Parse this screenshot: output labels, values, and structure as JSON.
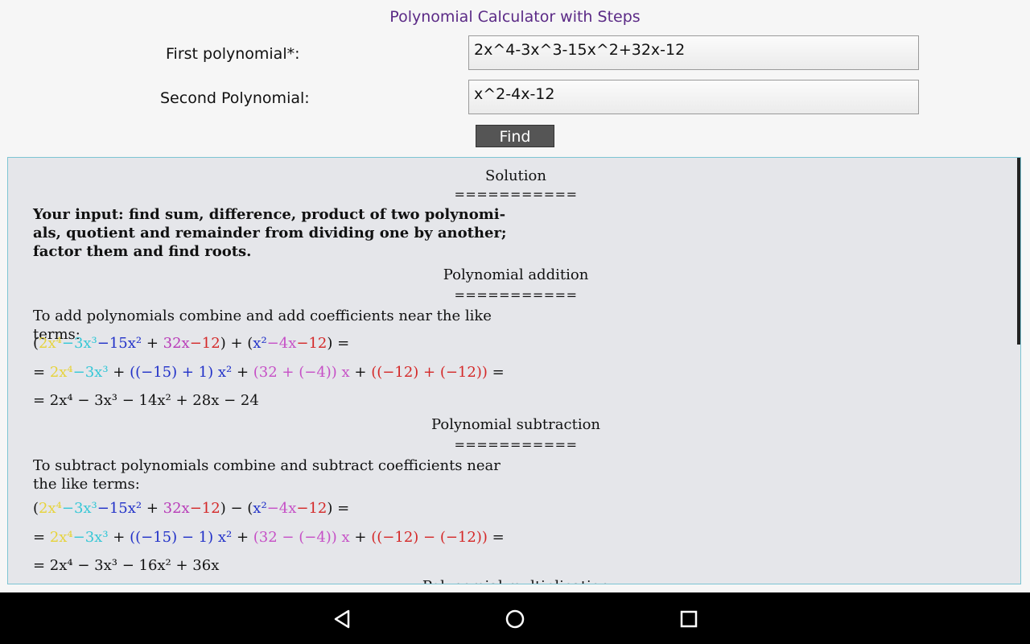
{
  "header": {
    "title": "Polynomial Calculator with Steps"
  },
  "form": {
    "first_label": "First polynomial*:",
    "first_value": "2x^4-3x^3-15x^2+32x-12",
    "second_label": "Second Polynomial:",
    "second_value": "x^2-4x-12",
    "find_label": "Find"
  },
  "result": {
    "solution_title": "Solution",
    "sep": "===========",
    "input_text": "Your input: find sum, difference, product of two polynomi- als, quotient and remainder from dividing one by another; factor them and find roots.",
    "add_title": "Polynomial addition",
    "add_text": "To add polynomials combine and add coefficients near the like terms:",
    "add_line1": {
      "open1": "(",
      "t1": "2x⁴",
      "t2": "−3x³",
      "t3": "−15x²",
      "plus": " + ",
      "t4": "32x",
      "t5": "−12",
      "mid": ") + (",
      "u1": "x²",
      "u2": "−4x",
      "u3": "−12",
      "end": ") ="
    },
    "add_line2": {
      "pre": "= ",
      "t1": "2x⁴",
      "t2": "−3x³",
      "p1": " + ",
      "b": "((−15) + 1) x²",
      "p2": " + ",
      "m": "(32 + (−4)) x",
      "p3": " + ",
      "r": "((−12) + (−12))",
      "end": " ="
    },
    "add_result": "= 2x⁴ − 3x³ − 14x² + 28x − 24",
    "sub_title": "Polynomial subtraction",
    "sub_text": "To subtract polynomials combine and subtract coefficients near the like terms:",
    "sub_line1": {
      "open1": "(",
      "t1": "2x⁴",
      "t2": "−3x³",
      "t3": "−15x²",
      "plus": " + ",
      "t4": "32x",
      "t5": "−12",
      "mid": ") − (",
      "u1": "x²",
      "u2": "−4x",
      "u3": "−12",
      "end": ") ="
    },
    "sub_line2": {
      "pre": "= ",
      "t1": "2x⁴",
      "t2": "−3x³",
      "p1": " + ",
      "b": "((−15) − 1) x²",
      "p2": " + ",
      "m": "(32 − (−4)) x",
      "p3": " + ",
      "r": "((−12) − (−12))",
      "end": " ="
    },
    "sub_result": "= 2x⁴ − 3x³ − 16x² + 36x",
    "mul_title": "Polynomial multiplication"
  },
  "nav": {
    "back": "back-icon",
    "home": "home-icon",
    "recents": "recents-icon"
  }
}
